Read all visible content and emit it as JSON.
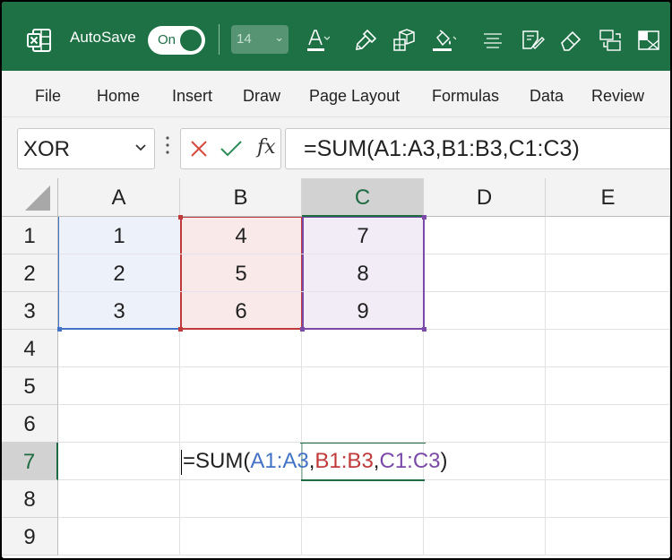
{
  "title_bar": {
    "autosave_label": "AutoSave",
    "autosave_state": "On",
    "font_size": "14",
    "icons": [
      "excel-logo-icon",
      "font-color-icon",
      "format-painter-icon",
      "copy-format-icon",
      "fill-color-icon",
      "align-icon",
      "clear-format-icon",
      "eraser-icon",
      "convert-icon",
      "sheet-icon"
    ],
    "background": "#1e7145"
  },
  "menu": {
    "items": [
      "File",
      "Home",
      "Insert",
      "Draw",
      "Page Layout",
      "Formulas",
      "Data",
      "Review"
    ]
  },
  "formula_bar": {
    "name_box": "XOR",
    "fx_label": "fx",
    "formula": "=SUM(A1:A3,B1:B3,C1:C3)"
  },
  "sheet": {
    "columns": [
      "A",
      "B",
      "C",
      "D",
      "E"
    ],
    "rows": [
      "1",
      "2",
      "3",
      "4",
      "5",
      "6",
      "7",
      "8",
      "9"
    ],
    "selected_column": "C",
    "selected_row": "7",
    "cells": {
      "A1": "1",
      "A2": "2",
      "A3": "3",
      "B1": "4",
      "B2": "5",
      "B3": "6",
      "C1": "7",
      "C2": "8",
      "C3": "9"
    },
    "edit_formula": {
      "prefix": "=SUM(",
      "ref1": "A1:A3",
      "sep1": ",",
      "ref2": "B1:B3",
      "sep2": ",",
      "ref3": "C1:C3",
      "suffix": ")"
    },
    "range_colors": {
      "A1:A3": "#4472c4",
      "B1:B3": "#c0393b",
      "C1:C3": "#7b49a8"
    }
  }
}
